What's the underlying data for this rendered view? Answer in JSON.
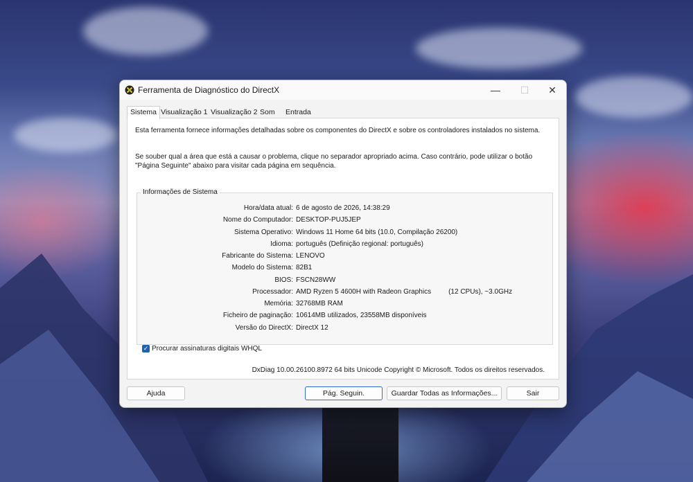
{
  "window": {
    "title": "Ferramenta de Diagnóstico do DirectX",
    "minimize_label": "—",
    "maximize_label": "☐",
    "close_label": "✕",
    "app_icon": "directx-icon"
  },
  "tabs": [
    {
      "label": "Sistema",
      "active": true
    },
    {
      "label": "Visualização 1",
      "active": false
    },
    {
      "label": "Visualização 2",
      "active": false
    },
    {
      "label": "Som",
      "active": false
    },
    {
      "label": "Entrada",
      "active": false
    }
  ],
  "intro": {
    "line1": "Esta ferramenta fornece informações detalhadas sobre os componentes do DirectX e sobre os controladores instalados no sistema.",
    "line2": "Se souber qual a área que está a causar o problema, clique no separador apropriado acima. Caso contrário, pode utilizar o botão \"Página Seguinte\" abaixo para visitar cada página em sequência."
  },
  "system_info": {
    "group_title": "Informações de Sistema",
    "rows": [
      {
        "label": "Hora/data atual:",
        "value": "6 de agosto de 2026, 14:38:29"
      },
      {
        "label": "Nome do Computador:",
        "value": "DESKTOP-PUJ5JEP"
      },
      {
        "label": "Sistema Operativo:",
        "value": "Windows 11 Home 64 bits (10.0, Compilação 26200)"
      },
      {
        "label": "Idioma:",
        "value": "português (Definição regional: português)"
      },
      {
        "label": "Fabricante do Sistema:",
        "value": "LENOVO"
      },
      {
        "label": "Modelo do Sistema:",
        "value": "82B1"
      },
      {
        "label": "BIOS:",
        "value": "FSCN28WW"
      },
      {
        "label": "Processador:",
        "value": "AMD Ryzen 5 4600H with Radeon Graphics         (12 CPUs), ~3.0GHz"
      },
      {
        "label": "Memória:",
        "value": "32768MB RAM"
      },
      {
        "label": "Ficheiro de paginação:",
        "value": "10614MB utilizados, 23558MB disponíveis"
      },
      {
        "label": "Versão do DirectX:",
        "value": "DirectX 12"
      }
    ]
  },
  "whql": {
    "label": "Procurar assinaturas digitais WHQL",
    "checked": true,
    "check_glyph": "✓"
  },
  "copyright": "DxDiag 10.00.26100.8972 64 bits Unicode Copyright © Microsoft. Todos os direitos reservados.",
  "buttons": {
    "help": "Ajuda",
    "next": "Pág. Seguin.",
    "save_all": "Guardar Todas as Informações...",
    "exit": "Sair"
  },
  "colors": {
    "accent": "#2f6bd1",
    "checkbox": "#1f63b0"
  }
}
